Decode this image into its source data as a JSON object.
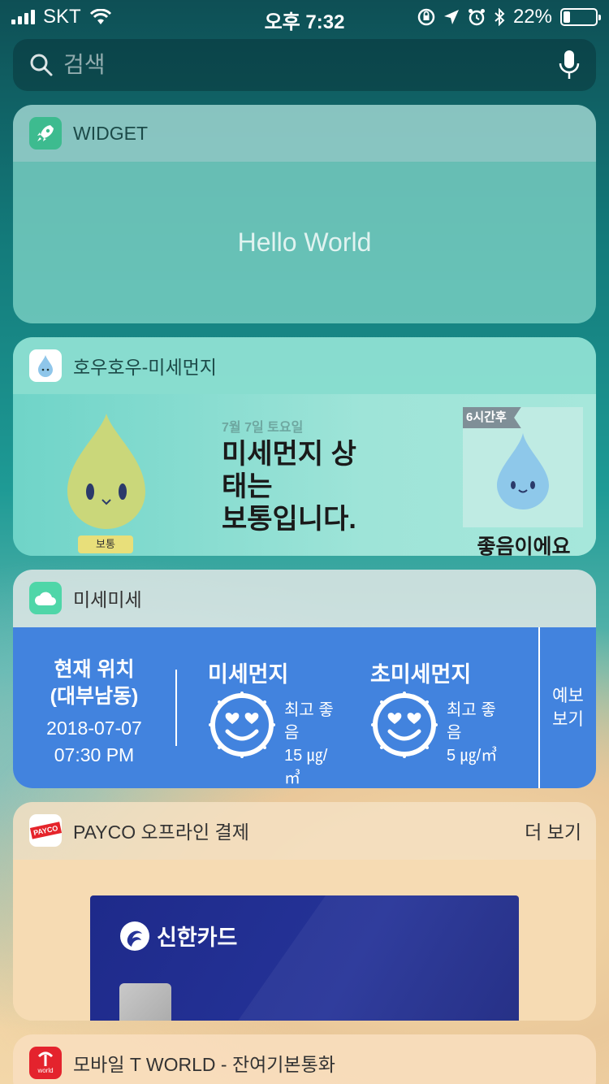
{
  "status": {
    "carrier": "SKT",
    "time": "오후 7:32",
    "battery_percent": "22%",
    "battery_level": 0.22
  },
  "search": {
    "placeholder": "검색"
  },
  "widget1": {
    "title": "WIDGET",
    "body": "Hello World",
    "accent": "#3dbb8f"
  },
  "widget2": {
    "title": "호우호우-미세먼지",
    "date": "7월 7일 토요일",
    "status_line1": "미세먼지 상",
    "status_line2": "태는",
    "status_line3": "보통입니다.",
    "mascot_label": "보통",
    "forecast_tag": "6시간후",
    "forecast_status": "좋음이에요"
  },
  "widget3": {
    "title": "미세미세",
    "location_line1": "현재 위치",
    "location_line2": "(대부남동)",
    "date": "2018-07-07",
    "time": "07:30 PM",
    "pm10": {
      "name": "미세먼지",
      "grade": "최고 좋음",
      "value": "15 ㎍/㎥"
    },
    "pm25": {
      "name": "초미세먼지",
      "grade": "최고 좋음",
      "value": "5 ㎍/㎥"
    },
    "forecast_line1": "예보",
    "forecast_line2": "보기",
    "accent": "#4283de"
  },
  "widget4": {
    "title": "PAYCO 오프라인 결제",
    "more": "더 보기",
    "icon_text": "PAYCO",
    "card_brand": "신한카드"
  },
  "widget5": {
    "title": "모바일 T WORLD - 잔여기본통화",
    "icon_text": "world"
  }
}
